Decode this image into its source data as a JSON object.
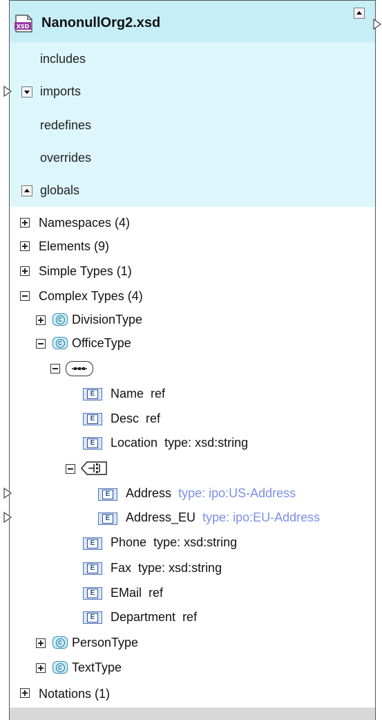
{
  "header": {
    "title": "NanonullOrg2.xsd",
    "file_icon_label": "XSD",
    "sections": [
      {
        "label": "includes"
      },
      {
        "label": "imports"
      },
      {
        "label": "redefines"
      },
      {
        "label": "overrides"
      },
      {
        "label": "globals"
      }
    ]
  },
  "tree": {
    "namespaces": "Namespaces (4)",
    "elements": "Elements (9)",
    "simple_types": "Simple Types (1)",
    "complex_types": "Complex Types (4)",
    "division_type": "DivisionType",
    "office_type": "OfficeType",
    "children": [
      {
        "name": "Name",
        "detail": "ref"
      },
      {
        "name": "Desc",
        "detail": "ref"
      },
      {
        "name": "Location",
        "detail": "type: xsd:string"
      }
    ],
    "choice_children": [
      {
        "name": "Address",
        "detail": "type: ipo:US-Address"
      },
      {
        "name": "Address_EU",
        "detail": "type: ipo:EU-Address"
      }
    ],
    "more_children": [
      {
        "name": "Phone",
        "detail": "type: xsd:string"
      },
      {
        "name": "Fax",
        "detail": "type: xsd:string"
      },
      {
        "name": "EMail",
        "detail": "ref"
      },
      {
        "name": "Department",
        "detail": "ref"
      }
    ],
    "person_type": "PersonType",
    "text_type": "TextType",
    "notations": "Notations (1)"
  },
  "icons": {
    "element_badge": "E",
    "complex_badge": "C"
  },
  "colors": {
    "header_bg": "#ddf6fb",
    "title_bg": "#c6eef6",
    "type_blue": "#7d8fe8"
  }
}
